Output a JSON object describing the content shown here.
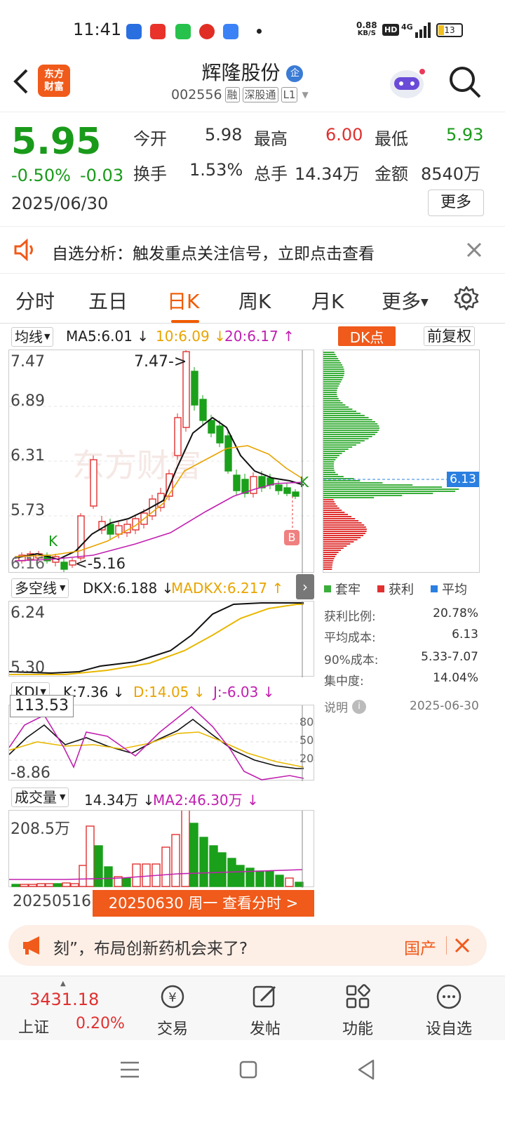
{
  "status": {
    "time": "11:41",
    "net_speed_value": "0.88",
    "net_speed_unit": "KB/S",
    "hd": "HD",
    "network": "4G",
    "battery": "13",
    "app_icons": [
      "toutiao-icon",
      "iqiyi-icon",
      "pinduoduo-icon",
      "app-icon"
    ]
  },
  "header": {
    "brand_line1": "东方",
    "brand_line2": "财富",
    "name": "辉隆股份",
    "badge": "企",
    "code": "002556",
    "tags": [
      "融",
      "深股通",
      "L1"
    ]
  },
  "quote": {
    "price": "5.95",
    "change_pct": "-0.50%",
    "change": "-0.03",
    "date": "2025/06/30",
    "fields": [
      {
        "label": "今开",
        "value": "5.98",
        "color": "#333333"
      },
      {
        "label": "最高",
        "value": "6.00",
        "color": "#e03030"
      },
      {
        "label": "最低",
        "value": "5.93",
        "color": "#1a9a1a"
      },
      {
        "label": "换手",
        "value": "1.53%",
        "color": "#333333"
      },
      {
        "label": "总手",
        "value": "14.34万",
        "color": "#333333"
      },
      {
        "label": "金额",
        "value": "8540万",
        "color": "#333333"
      }
    ],
    "more_button": "更多"
  },
  "notice": {
    "text": "自选分析：触发重点关注信号，立即点击查看"
  },
  "tabs": [
    "分时",
    "五日",
    "日K",
    "周K",
    "月K",
    "更多"
  ],
  "kline": {
    "indicator_select": "均线",
    "ma5": "MA5:6.01",
    "ma10": "10:6.09",
    "ma20": "20:6.17",
    "dk_button": "DK点",
    "adjust_button": "前复权",
    "y_labels": [
      "7.47",
      "6.89",
      "6.31",
      "5.73",
      "6.16"
    ],
    "high_marker": "7.47->",
    "low_marker": "<-5.16",
    "k_mark": "K",
    "b_mark": "B",
    "watermark": "东方财富"
  },
  "chips": {
    "price_tag": "6.13",
    "legend": [
      "套牢",
      "获利",
      "平均"
    ],
    "rows": [
      {
        "label": "获利比例:",
        "value": "20.78%"
      },
      {
        "label": "平均成本:",
        "value": "6.13"
      },
      {
        "label": "90%成本:",
        "value": "5.33-7.07"
      },
      {
        "label": "集中度:",
        "value": "14.04%"
      }
    ],
    "note_label": "说明",
    "note_date": "2025-06-30"
  },
  "dkx": {
    "select": "多空线",
    "dkx": "DKX:6.188",
    "madkx": "MADKX:6.217",
    "y_top": "6.24",
    "y_bottom": "5.30"
  },
  "kdj": {
    "select": "KDJ",
    "k": "K:7.36",
    "d": "D:14.05",
    "j": "J:-6.03",
    "cursor_value": "113.53",
    "y_bottom": "-8.86",
    "levels": [
      "80",
      "50",
      "20"
    ]
  },
  "volume": {
    "select": "成交量",
    "vol": "14.34万",
    "ma2": "MA2:46.30万",
    "y_top": "208.5万",
    "start_date": "20250516",
    "cursor_label": "20250630 周一 查看分时 >"
  },
  "ad": {
    "text": "刻”，布局创新药机会来了?",
    "tag": "国产"
  },
  "bottom_nav": {
    "index_value": "3431.18",
    "index_name": "上证",
    "index_change": "0.20%",
    "items": [
      "交易",
      "发帖",
      "功能",
      "设自选"
    ]
  }
}
